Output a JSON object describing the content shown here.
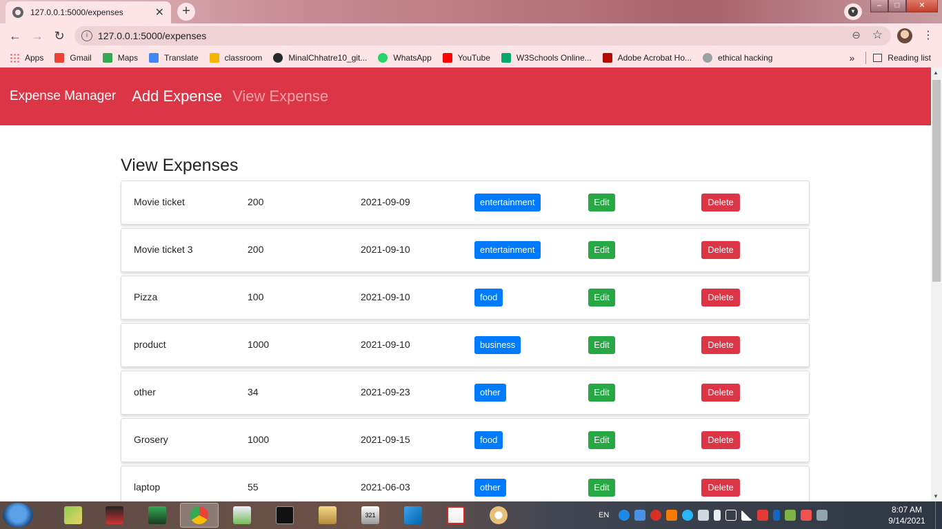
{
  "browser": {
    "tab_title": "127.0.0.1:5000/expenses",
    "tab_close": "✕",
    "new_tab": "+",
    "url": "127.0.0.1:5000/expenses",
    "bookmarks": [
      {
        "label": "Apps",
        "icon": "apps-grid-icon",
        "color": "#e8453c"
      },
      {
        "label": "Gmail",
        "icon": "gmail-icon",
        "color": "#ea4335"
      },
      {
        "label": "Maps",
        "icon": "maps-pin-icon",
        "color": "#34a853"
      },
      {
        "label": "Translate",
        "icon": "translate-icon",
        "color": "#4285f4"
      },
      {
        "label": "classroom",
        "icon": "classroom-icon",
        "color": "#f4b400"
      },
      {
        "label": "MinalChhatre10_git...",
        "icon": "github-icon",
        "color": "#24292e"
      },
      {
        "label": "WhatsApp",
        "icon": "whatsapp-icon",
        "color": "#25d366"
      },
      {
        "label": "YouTube",
        "icon": "youtube-icon",
        "color": "#ff0000"
      },
      {
        "label": "W3Schools Online...",
        "icon": "w3schools-icon",
        "color": "#04aa6d"
      },
      {
        "label": "Adobe Acrobat Ho...",
        "icon": "acrobat-icon",
        "color": "#b30b00"
      },
      {
        "label": "ethical hacking",
        "icon": "globe-icon",
        "color": "#9aa0a6"
      }
    ],
    "more_bookmarks": "»",
    "reading_list": "Reading list"
  },
  "app": {
    "brand": "Expense Manager",
    "nav": {
      "add": "Add Expense",
      "view": "View Expense"
    },
    "heading": "View Expenses",
    "edit_label": "Edit",
    "delete_label": "Delete",
    "colors": {
      "navbar": "#dc3545",
      "badge": "#007bff",
      "edit": "#28a745",
      "delete": "#dc3545"
    },
    "expenses": [
      {
        "name": "Movie ticket",
        "amount": "200",
        "date": "2021-09-09",
        "category": "entertainment"
      },
      {
        "name": "Movie ticket 3",
        "amount": "200",
        "date": "2021-09-10",
        "category": "entertainment"
      },
      {
        "name": "Pizza",
        "amount": "100",
        "date": "2021-09-10",
        "category": "food"
      },
      {
        "name": "product",
        "amount": "1000",
        "date": "2021-09-10",
        "category": "business"
      },
      {
        "name": "other",
        "amount": "34",
        "date": "2021-09-23",
        "category": "other"
      },
      {
        "name": "Grosery",
        "amount": "1000",
        "date": "2021-09-15",
        "category": "food"
      },
      {
        "name": "laptop",
        "amount": "55",
        "date": "2021-06-03",
        "category": "other"
      }
    ]
  },
  "taskbar": {
    "language": "EN",
    "time": "8:07 AM",
    "date": "9/14/2021"
  }
}
